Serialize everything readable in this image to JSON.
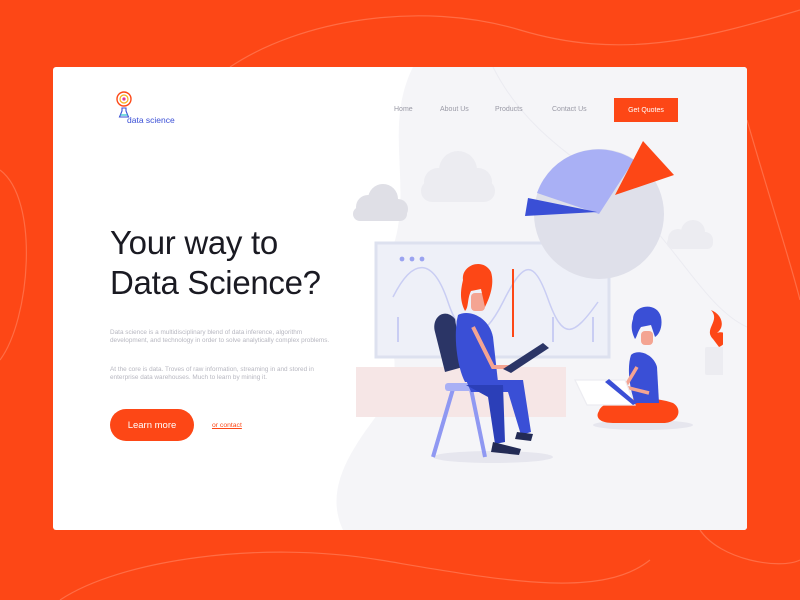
{
  "logo": {
    "text": "data science"
  },
  "nav": {
    "items": [
      {
        "label": "Home"
      },
      {
        "label": "About Us"
      },
      {
        "label": "Products"
      },
      {
        "label": "Contact Us"
      }
    ],
    "cta_label": "Get Quotes"
  },
  "hero": {
    "headline_line1": "Your way to",
    "headline_line2": "Data Science?",
    "paragraph1": "Data science is a multidisciplinary blend of data inference, algorithm development, and technology in order to solve analytically complex problems.",
    "paragraph2": "At the core is data. Troves of raw information, streaming in and stored in enterprise data warehouses. Much to learn by mining it.",
    "primary_button": "Learn more",
    "secondary_link": "or contact"
  },
  "colors": {
    "accent": "#fd4716",
    "brand_blue": "#3a4fd6",
    "text_dark": "#1a1a22",
    "text_muted": "#b7b7c0"
  }
}
